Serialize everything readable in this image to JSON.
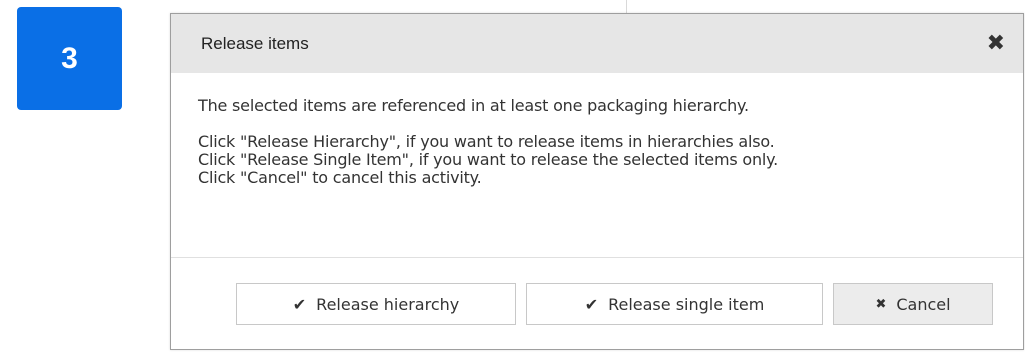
{
  "step_badge": {
    "number": "3",
    "color": "#0a6fe6"
  },
  "dialog": {
    "title": "Release items",
    "close_icon": "close-icon",
    "body": {
      "lead": "The selected items are referenced in at least one packaging hierarchy.",
      "lines": [
        "Click \"Release Hierarchy\", if you want to release items in hierarchies also.",
        "Click \"Release Single Item\", if you want to release the selected items only.",
        "Click \"Cancel\" to cancel this activity."
      ]
    },
    "buttons": {
      "release_hierarchy": {
        "label": "Release hierarchy",
        "icon": "checkmark-icon"
      },
      "release_single": {
        "label": "Release single item",
        "icon": "checkmark-icon"
      },
      "cancel": {
        "label": "Cancel",
        "icon": "x-icon"
      }
    }
  }
}
